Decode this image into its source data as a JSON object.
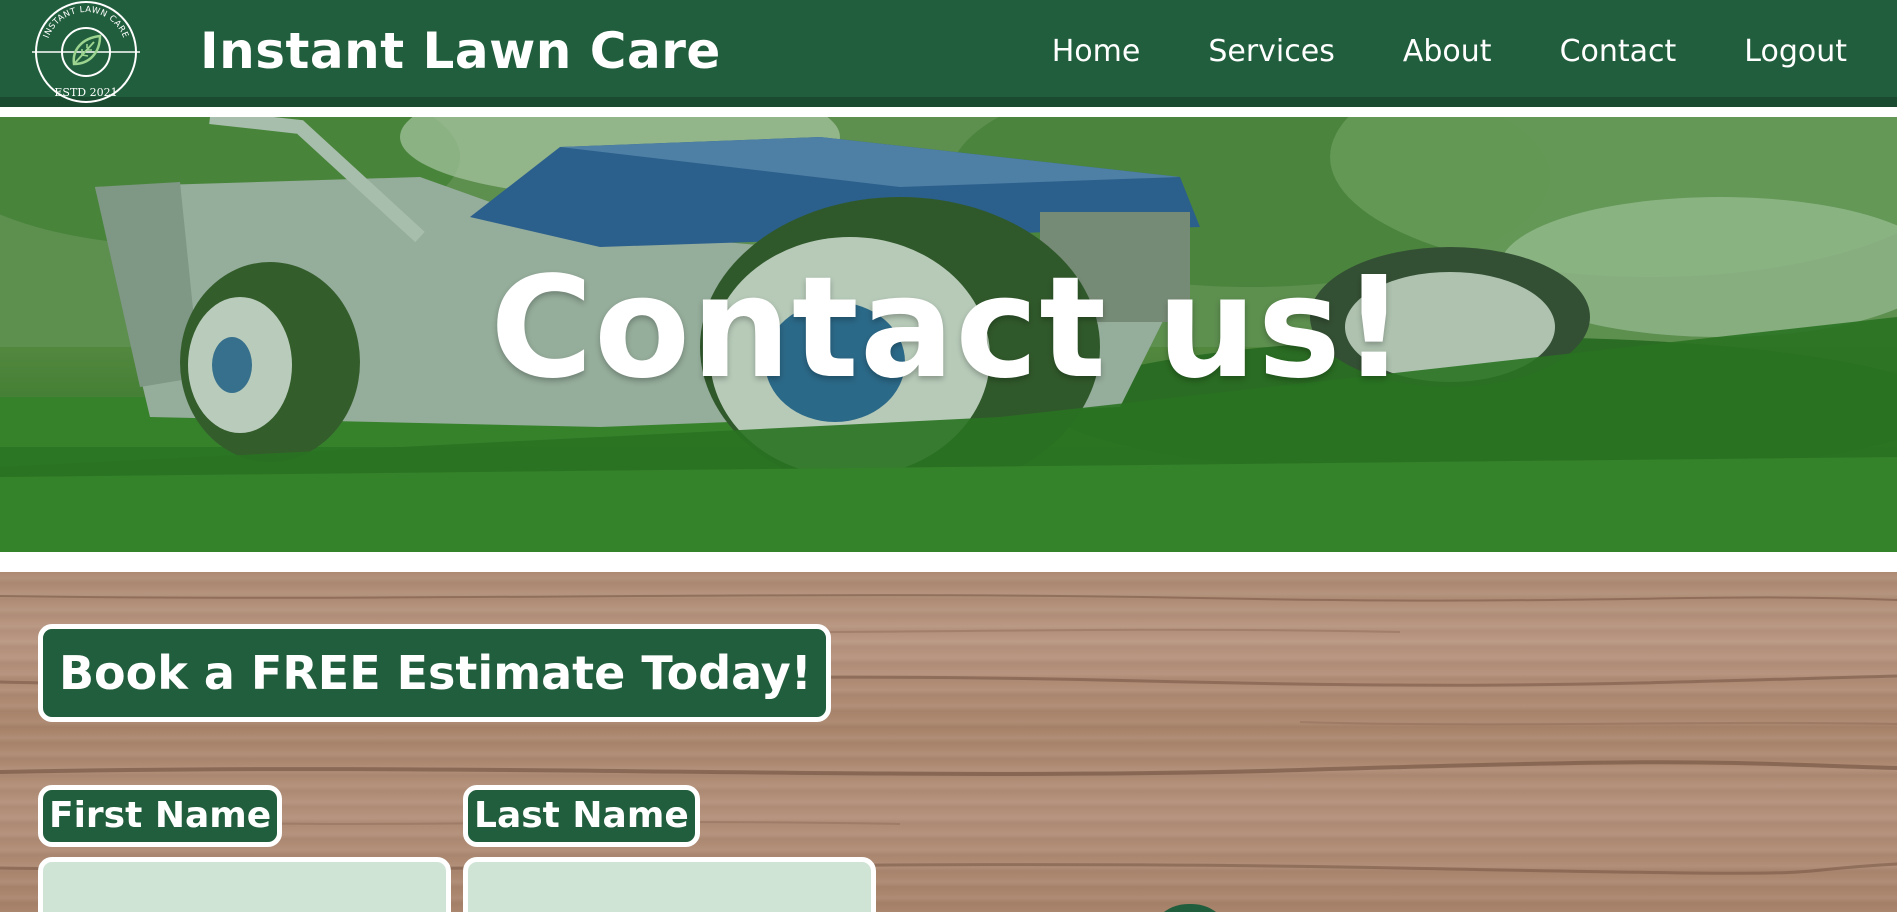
{
  "header": {
    "logo_icon": "leaf-badge-icon",
    "logo_text_top": "INSTANT LAWN CARE",
    "logo_text_bottom": "ESTD 2021",
    "site_title": "Instant Lawn Care",
    "nav": [
      {
        "label": "Home"
      },
      {
        "label": "Services"
      },
      {
        "label": "About"
      },
      {
        "label": "Contact"
      },
      {
        "label": "Logout"
      }
    ]
  },
  "hero": {
    "title": "Contact us!"
  },
  "estimate": {
    "heading": "Book a FREE Estimate Today!",
    "first_name_label": "First Name",
    "last_name_label": "Last Name",
    "first_name_value": "",
    "last_name_value": ""
  },
  "colors": {
    "brand_green": "#215e3d",
    "input_bg": "#d0e4d6",
    "text_white": "#ffffff"
  }
}
